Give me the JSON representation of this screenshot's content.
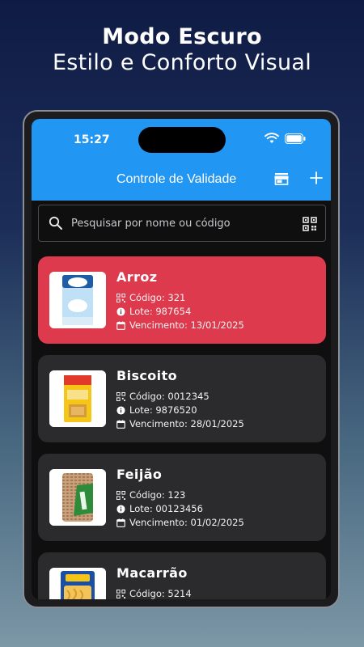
{
  "promo": {
    "title": "Modo Escuro",
    "subtitle": "Estilo e Conforto Visual"
  },
  "status_bar": {
    "time": "15:27"
  },
  "appbar": {
    "title": "Controle de Validade",
    "icons": [
      "store-icon",
      "add-icon"
    ]
  },
  "search": {
    "placeholder": "Pesquisar por nome ou código",
    "value": "",
    "icons": [
      "search-icon",
      "qr-code-icon"
    ]
  },
  "colors": {
    "appbar": "#2196f3",
    "expired_card": "#dd3a4e",
    "card": "#2b2b2d",
    "background": "#0f0f10"
  },
  "products": [
    {
      "name": "Arroz",
      "code_label": "Código: 321",
      "lot_label": "Lote: 987654",
      "expiry_label": "Vencimento: 13/01/2025",
      "status": "expired"
    },
    {
      "name": "Biscoito",
      "code_label": "Código: 0012345",
      "lot_label": "Lote: 9876520",
      "expiry_label": "Vencimento: 28/01/2025",
      "status": "ok"
    },
    {
      "name": "Feijão",
      "code_label": "Código: 123",
      "lot_label": "Lote: 00123456",
      "expiry_label": "Vencimento: 01/02/2025",
      "status": "ok"
    },
    {
      "name": "Macarrão",
      "code_label": "Código: 5214",
      "lot_label": "",
      "expiry_label": "",
      "status": "ok"
    }
  ]
}
